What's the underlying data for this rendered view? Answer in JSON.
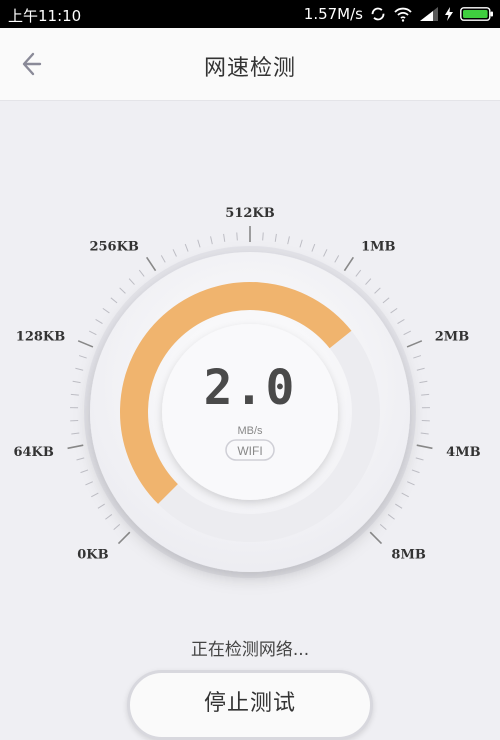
{
  "status_bar": {
    "time": "上午11:10",
    "speed": "1.57M/s",
    "icons": [
      "sync-icon",
      "wifi-icon",
      "signal-icon",
      "charging-icon",
      "battery-icon"
    ]
  },
  "header": {
    "title": "网速检测",
    "back_icon": "arrow-left-icon"
  },
  "gauge": {
    "scale_labels": [
      "0KB",
      "64KB",
      "128KB",
      "256KB",
      "512KB",
      "1MB",
      "2MB",
      "4MB",
      "8MB"
    ],
    "value": "2.0",
    "unit": "MB/s",
    "network_type": "WIFI",
    "progress_fraction": 0.69,
    "colors": {
      "progress": "#f0b46e",
      "track": "#ececf0",
      "dial": "#f7f7f9",
      "background": "#efeff3"
    }
  },
  "status_message": "正在检测网络...",
  "stop_button_label": "停止测试"
}
